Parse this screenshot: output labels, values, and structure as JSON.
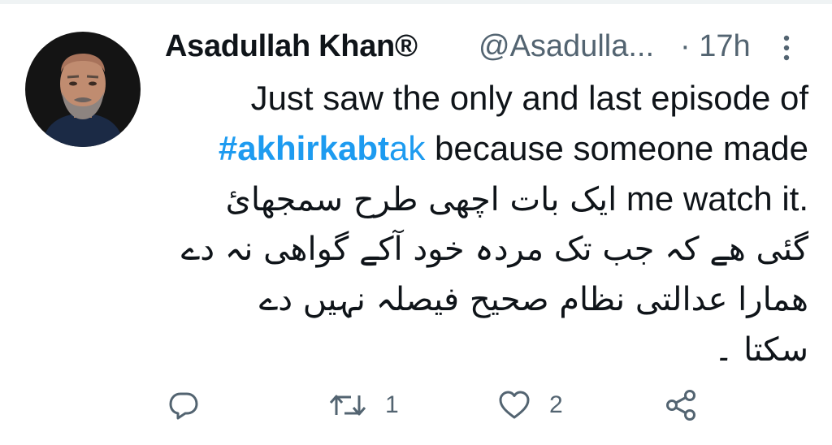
{
  "tweet": {
    "author": {
      "display_name": "Asadullah Khan®",
      "handle": "@Asadulla...",
      "avatar_icon": "profile-photo"
    },
    "time_separator": "·",
    "time": "17h",
    "more_icon": "more-vertical-icon",
    "text": {
      "line1": "Just saw the only and last episode of",
      "hashtag_bold": "#akhirkabt",
      "hashtag_rest": "ak",
      "line2_rest": " because someone made",
      "line3_urdu": "ایک بات اچھی طرح سمجھائ",
      "line3_eng": "me  watch it.",
      "line4": "گئی ھے کہ جب تک مردہ خود آکے گواھی نہ دے",
      "line5": "ھمارا عدالتی نظام صحیح  فیصلہ نہیں دے",
      "line6": "سکتا ۔"
    },
    "actions": {
      "reply_icon": "reply-icon",
      "retweet_icon": "retweet-icon",
      "retweet_count": "1",
      "like_icon": "heart-icon",
      "like_count": "2",
      "share_icon": "share-icon"
    }
  },
  "colors": {
    "text": "#0f1419",
    "secondary": "#536471",
    "link": "#1d9bf0",
    "divider": "#eff3f4"
  }
}
